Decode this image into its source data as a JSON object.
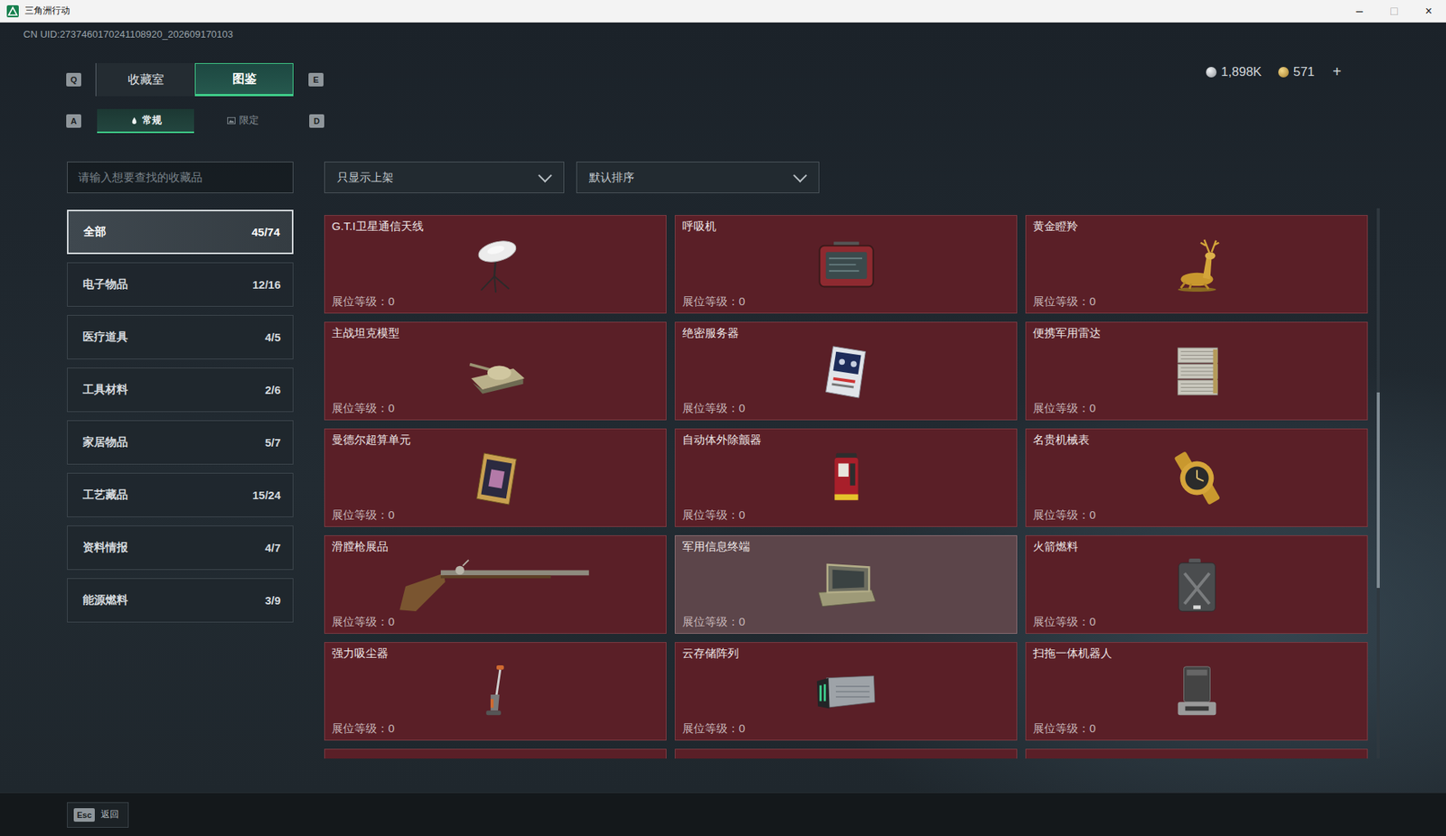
{
  "window": {
    "title": "三角洲行动",
    "controls": [
      {
        "glyph": "–",
        "disabled": false
      },
      {
        "glyph": "□",
        "disabled": true
      },
      {
        "glyph": "×",
        "disabled": false
      }
    ]
  },
  "uid": "CN UID:2737460170241108920_202609170103",
  "currency": {
    "items": [
      {
        "amount": "1,898K",
        "kind": "silver"
      },
      {
        "amount": "571",
        "kind": "gold"
      }
    ],
    "add": "+"
  },
  "main_tabs": {
    "prev_key": "Q",
    "next_key": "E",
    "items": [
      {
        "label": "收藏室",
        "selected": false
      },
      {
        "label": "图鉴",
        "selected": true
      }
    ]
  },
  "sub_tabs": {
    "prev_key": "A",
    "next_key": "D",
    "items": [
      {
        "label": "常规",
        "selected": true
      },
      {
        "label": "限定",
        "selected": false
      }
    ]
  },
  "search": {
    "placeholder": "请输入想要查找的收藏品"
  },
  "dropdowns": [
    {
      "value": "只显示上架"
    },
    {
      "value": "默认排序"
    }
  ],
  "categories": [
    {
      "name": "全部",
      "count": "45/74",
      "selected": true
    },
    {
      "name": "电子物品",
      "count": "12/16",
      "selected": false
    },
    {
      "name": "医疗道具",
      "count": "4/5",
      "selected": false
    },
    {
      "name": "工具材料",
      "count": "2/6",
      "selected": false
    },
    {
      "name": "家居物品",
      "count": "5/7",
      "selected": false
    },
    {
      "name": "工艺藏品",
      "count": "15/24",
      "selected": false
    },
    {
      "name": "资料情报",
      "count": "4/7",
      "selected": false
    },
    {
      "name": "能源燃料",
      "count": "3/9",
      "selected": false
    }
  ],
  "items": [
    {
      "name": "G.T.I卫星通信天线",
      "level": "展位等级：0",
      "highlighted": false
    },
    {
      "name": "呼吸机",
      "level": "展位等级：0",
      "highlighted": false
    },
    {
      "name": "黄金瞪羚",
      "level": "展位等级：0",
      "highlighted": false
    },
    {
      "name": "主战坦克模型",
      "level": "展位等级：0",
      "highlighted": false
    },
    {
      "name": "绝密服务器",
      "level": "展位等级：0",
      "highlighted": false
    },
    {
      "name": "便携军用雷达",
      "level": "展位等级：0",
      "highlighted": false
    },
    {
      "name": "曼德尔超算单元",
      "level": "展位等级：0",
      "highlighted": false
    },
    {
      "name": "自动体外除颤器",
      "level": "展位等级：0",
      "highlighted": false
    },
    {
      "name": "名贵机械表",
      "level": "展位等级：0",
      "highlighted": false
    },
    {
      "name": "滑膛枪展品",
      "level": "展位等级：0",
      "highlighted": false
    },
    {
      "name": "军用信息终端",
      "level": "展位等级：0",
      "highlighted": true
    },
    {
      "name": "火箭燃料",
      "level": "展位等级：0",
      "highlighted": false
    },
    {
      "name": "强力吸尘器",
      "level": "展位等级：0",
      "highlighted": false
    },
    {
      "name": "云存储阵列",
      "level": "展位等级：0",
      "highlighted": false
    },
    {
      "name": "扫拖一体机器人",
      "level": "展位等级：0",
      "highlighted": false
    }
  ],
  "scrollbar": {
    "start": 0.335,
    "size": 0.355
  },
  "footer": {
    "key": "Esc",
    "label": "返回"
  }
}
